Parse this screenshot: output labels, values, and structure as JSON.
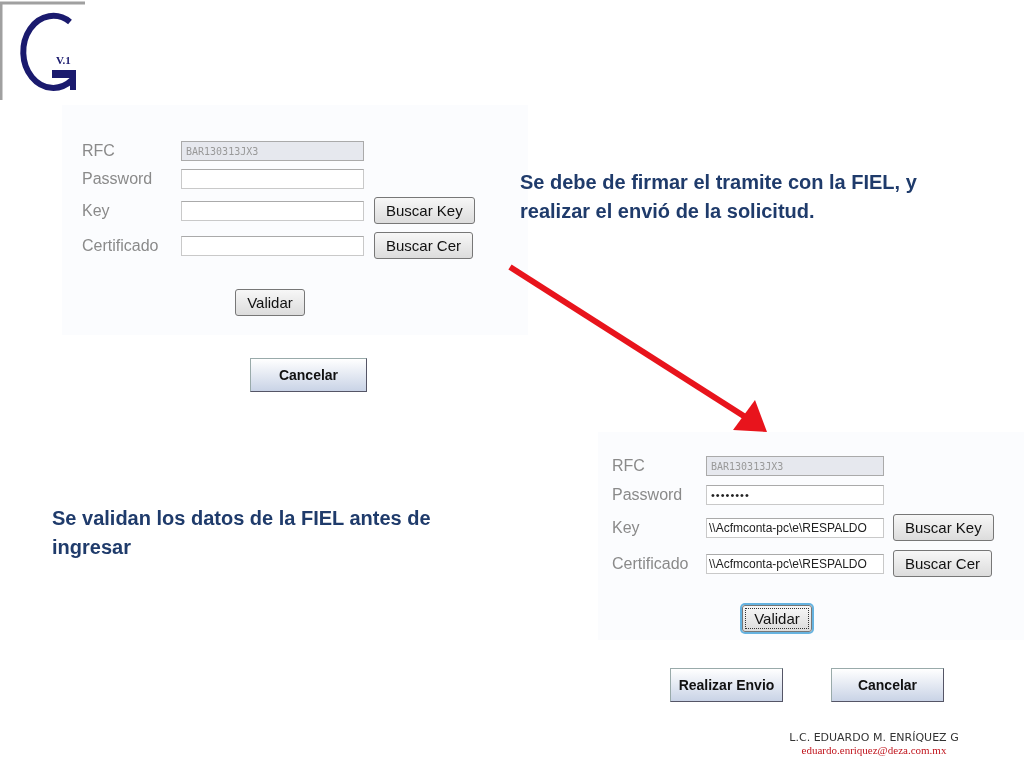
{
  "logo": {
    "text": "V.1"
  },
  "forms": [
    {
      "fields": [
        {
          "label": "RFC",
          "kind": "readonly",
          "value": "BAR130313JX3"
        },
        {
          "label": "Password",
          "kind": "password"
        },
        {
          "label": "Key",
          "kind": "text",
          "button": "Buscar Key"
        },
        {
          "label": "Certificado",
          "kind": "text",
          "button": "Buscar Cer"
        }
      ],
      "validate": {
        "label": "Validar",
        "focused": false
      },
      "actions": [
        "Cancelar"
      ]
    },
    {
      "fields": [
        {
          "label": "RFC",
          "kind": "readonly",
          "value": "BAR130313JX3"
        },
        {
          "label": "Password",
          "kind": "password",
          "value": "••••••••"
        },
        {
          "label": "Key",
          "kind": "text",
          "value": "\\\\Acfmconta-pc\\e\\RESPALDO",
          "button": "Buscar Key"
        },
        {
          "label": "Certificado",
          "kind": "text",
          "value": "\\\\Acfmconta-pc\\e\\RESPALDO",
          "button": "Buscar Cer"
        }
      ],
      "validate": {
        "label": "Validar",
        "focused": true
      },
      "actions": [
        "Realizar Envio",
        "Cancelar"
      ]
    }
  ],
  "captions": [
    "Se debe de firmar el tramite con la FIEL, y realizar el envió de la solicitud.",
    "Se validan los datos de la FIEL antes de ingresar"
  ],
  "footer": {
    "name": "L.C. EDUARDO M. ENRÍQUEZ G",
    "email": "eduardo.enriquez@deza.com.mx"
  }
}
